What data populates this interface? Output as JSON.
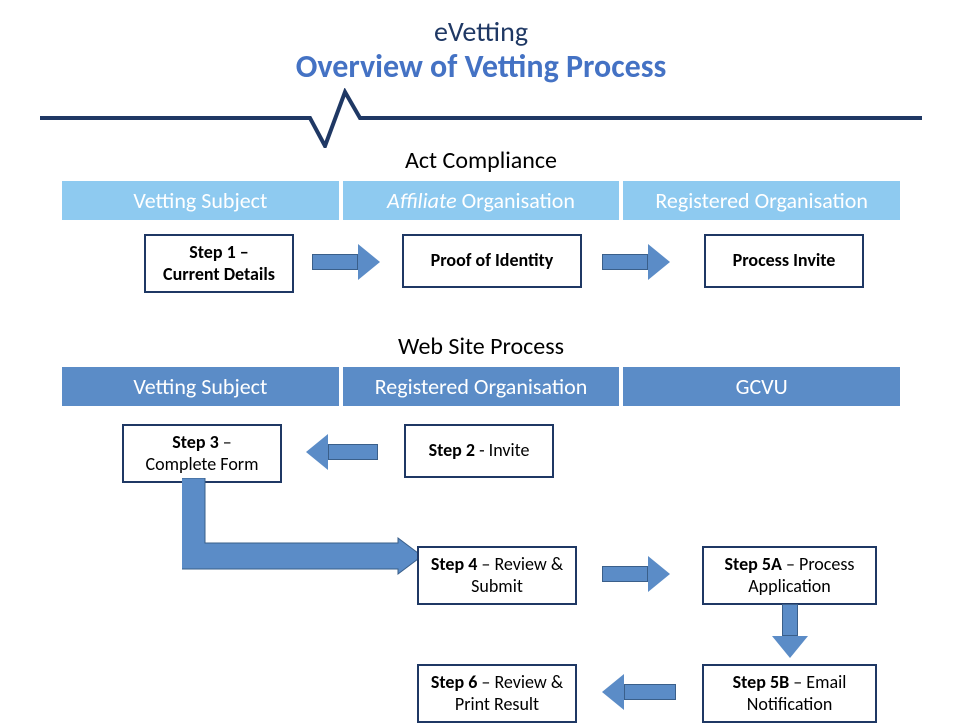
{
  "header": {
    "title1": "eVetting",
    "title2": "Overview of Vetting Process"
  },
  "section1": {
    "title": "Act Compliance",
    "columns": [
      "Vetting Subject",
      "Affiliate Organisation",
      "Registered Organisation"
    ],
    "nodes": {
      "step1_label": "Step 1",
      "step1_sub": "Current Details",
      "proof": "Proof  of Identity",
      "process_invite": "Process Invite"
    }
  },
  "section2": {
    "title": "Web Site Process",
    "columns": [
      "Vetting Subject",
      "Registered Organisation",
      "GCVU"
    ],
    "nodes": {
      "step2_label": "Step 2",
      "step2_sub": "Invite",
      "step3_label": "Step 3",
      "step3_sub": "Complete  Form",
      "step4_label": "Step 4",
      "step4_sub": "Review & Submit",
      "step5a_label": "Step 5A",
      "step5a_sub": "Process Application",
      "step5b_label": "Step 5B",
      "step5b_sub": "Email Notification",
      "step6_label": "Step 6",
      "step6_sub": "Review & Print Result"
    }
  }
}
